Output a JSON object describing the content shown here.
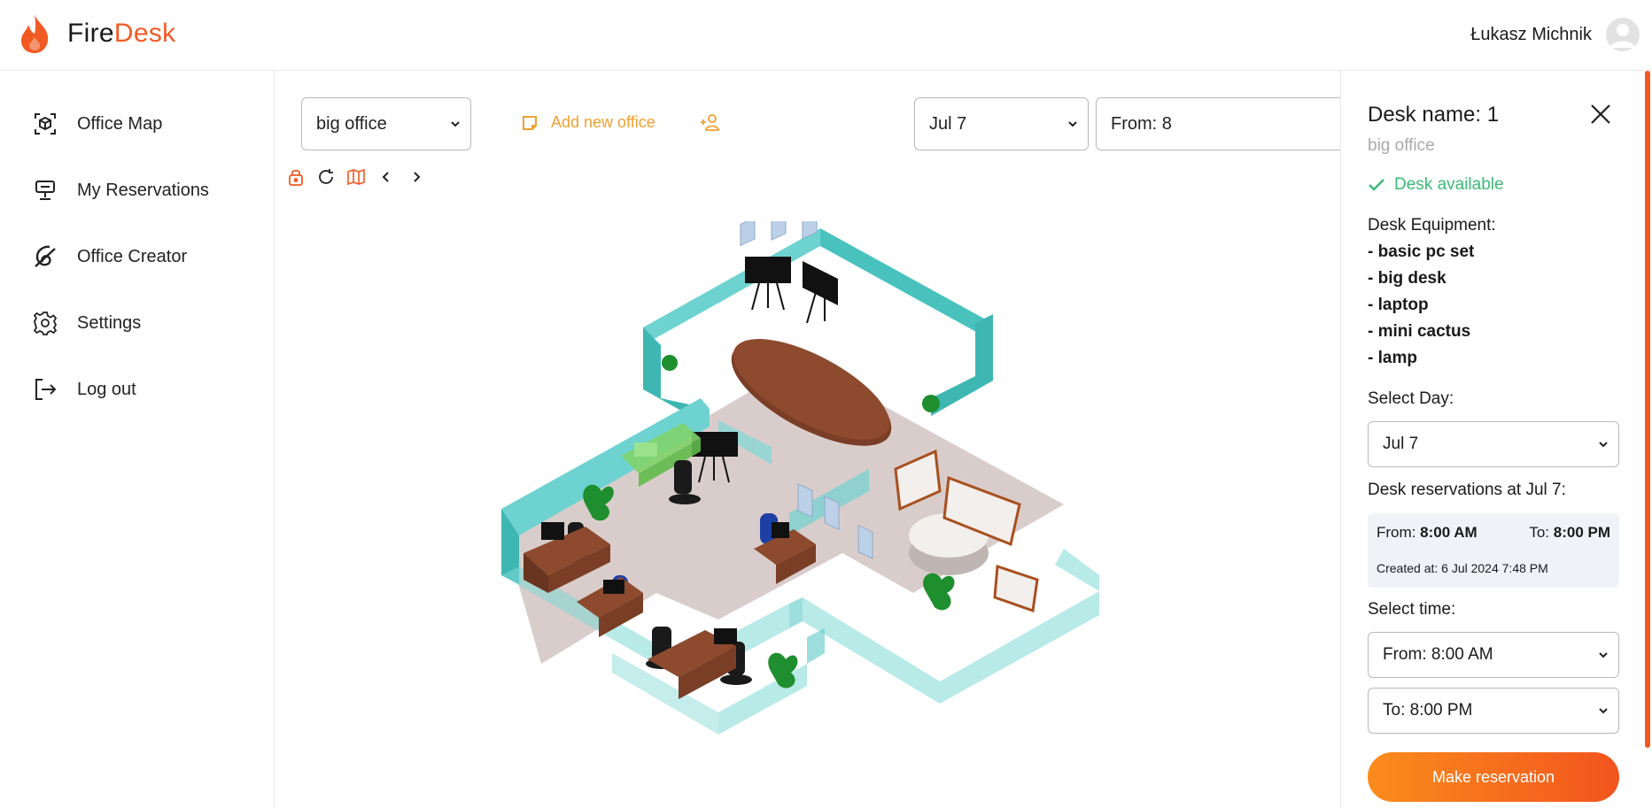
{
  "brand": {
    "fire": "Fire",
    "desk": "Desk",
    "accent": "#f25a24"
  },
  "user": {
    "name": "Łukasz Michnik"
  },
  "sidebar": {
    "items": [
      {
        "label": "Office Map",
        "icon": "cube-icon"
      },
      {
        "label": "My Reservations",
        "icon": "desk-icon"
      },
      {
        "label": "Office Creator",
        "icon": "creator-icon"
      },
      {
        "label": "Settings",
        "icon": "gear-icon"
      },
      {
        "label": "Log out",
        "icon": "logout-icon"
      }
    ]
  },
  "toolbar": {
    "office_select": "big office",
    "add_office_label": "Add new office",
    "date_select": "Jul 7",
    "from_select": "From: 8"
  },
  "panel": {
    "title": "Desk name: 1",
    "subtitle": "big office",
    "status": "Desk available",
    "equipment_title": "Desk Equipment:",
    "equipment": [
      "- basic pc set",
      "- big desk",
      "- laptop",
      "- mini cactus",
      "- lamp"
    ],
    "select_day_label": "Select Day:",
    "select_day_value": "Jul 7",
    "reservations_label": "Desk reservations at Jul 7:",
    "reservation": {
      "from_label": "From:",
      "from_value": "8:00 AM",
      "to_label": "To:",
      "to_value": "8:00 PM",
      "created": "Created at: 6 Jul 2024 7:48 PM"
    },
    "select_time_label": "Select time:",
    "time_from": "From: 8:00 AM",
    "time_to": "To: 8:00 PM",
    "button": "Make reservation"
  }
}
